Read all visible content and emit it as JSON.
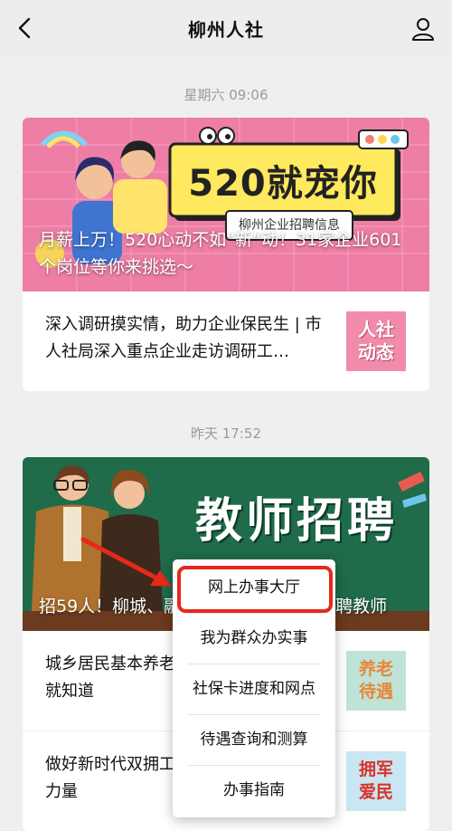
{
  "nav": {
    "title": "柳州人社",
    "back_icon": "chevron-left-icon",
    "user_icon": "user-icon"
  },
  "feed": [
    {
      "time": "星期六 09:06",
      "cover": {
        "badge_text": "520就宠你",
        "tag_text": "柳州企业招聘信息",
        "caption": "月薪上万！520心动不如“新”动！31家企业601个岗位等你来挑选～",
        "bg_color": "#ee7ea6"
      },
      "sub_items": [
        {
          "title": "深入调研摸实情，助力企业保民生 | 市人社局深入重点企业走访调研工…",
          "thumb_text": [
            "人社",
            "动态"
          ],
          "thumb_color": "#f28ba9"
        }
      ]
    },
    {
      "time": "昨天 17:52",
      "cover": {
        "badge_text": "教师招聘",
        "caption": "招59人！柳城、融水县这些学校公开招聘教师",
        "bg_color": "#1f6b4a"
      },
      "sub_items": [
        {
          "title": "城乡居民基本养老保险待遇，看完这篇就知道",
          "thumb_text": [
            "养老",
            "待遇"
          ],
          "thumb_color": "#bfe3d6"
        },
        {
          "title": "做好新时代双拥工作，为强军汇聚强大力量",
          "thumb_text": [
            "拥军",
            "爱民"
          ],
          "thumb_color": "#c9e6f2"
        }
      ]
    }
  ],
  "menu": {
    "items": [
      "网上办事大厅",
      "我为群众办实事",
      "社保卡进度和网点",
      "待遇查询和测算",
      "办事指南"
    ],
    "highlighted_index": 0,
    "highlight_color": "#e62a1a",
    "arrow_color": "#e62a1a"
  }
}
